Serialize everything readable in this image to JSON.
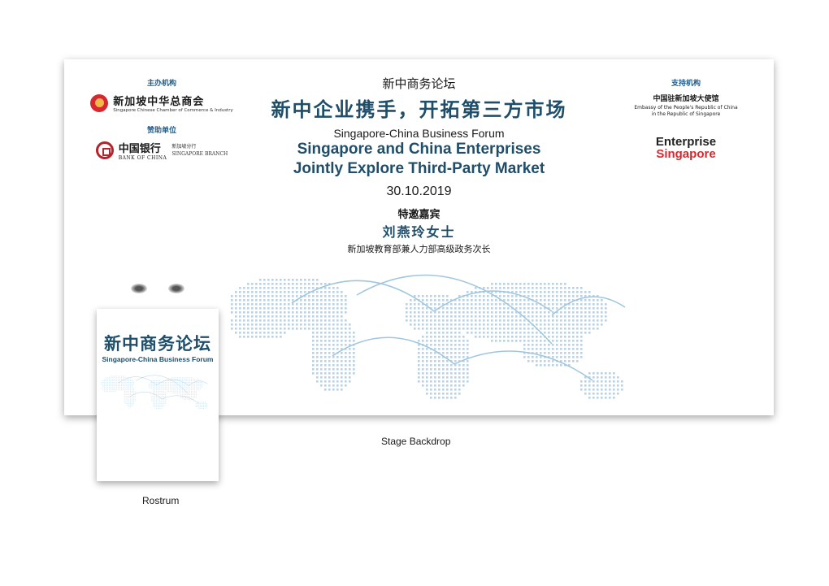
{
  "backdrop": {
    "organizer_label": "主办机构",
    "organizer_cn": "新加坡中华总商会",
    "organizer_en": "Singapore Chinese Chamber of Commerce & Industry",
    "sponsor_label": "赞助单位",
    "sponsor_cn": "中国银行",
    "sponsor_en": "BANK OF CHINA",
    "sponsor_branch_cn": "新加坡分行",
    "sponsor_branch_en": "SINGAPORE BRANCH",
    "supporter_label": "支持机构",
    "embassy_cn": "中国驻新加坡大使馆",
    "embassy_en_line1": "Embassy of the People's Republic of China",
    "embassy_en_line2": "in the Republic of Singapore",
    "enterprise_line1": "Enterprise",
    "enterprise_line2": "Singapore",
    "forum_cn": "新中商务论坛",
    "headline_cn": "新中企业携手，开拓第三方市场",
    "forum_en": "Singapore-China Business Forum",
    "headline_en_line1": "Singapore and China Enterprises",
    "headline_en_line2": "Jointly Explore Third-Party Market",
    "date": "30.10.2019",
    "guest_label": "特邀嘉宾",
    "guest_name": "刘燕玲女士",
    "guest_title": "新加坡教育部兼人力部高级政务次长"
  },
  "rostrum": {
    "title_cn": "新中商务论坛",
    "title_en": "Singapore-China Business Forum"
  },
  "captions": {
    "backdrop": "Stage Backdrop",
    "rostrum": "Rostrum"
  },
  "colors": {
    "accent_navy": "#1f4e6b",
    "brand_red": "#d7282f",
    "map_dots": "#b9d3e4",
    "map_arcs": "#9fc6de"
  }
}
